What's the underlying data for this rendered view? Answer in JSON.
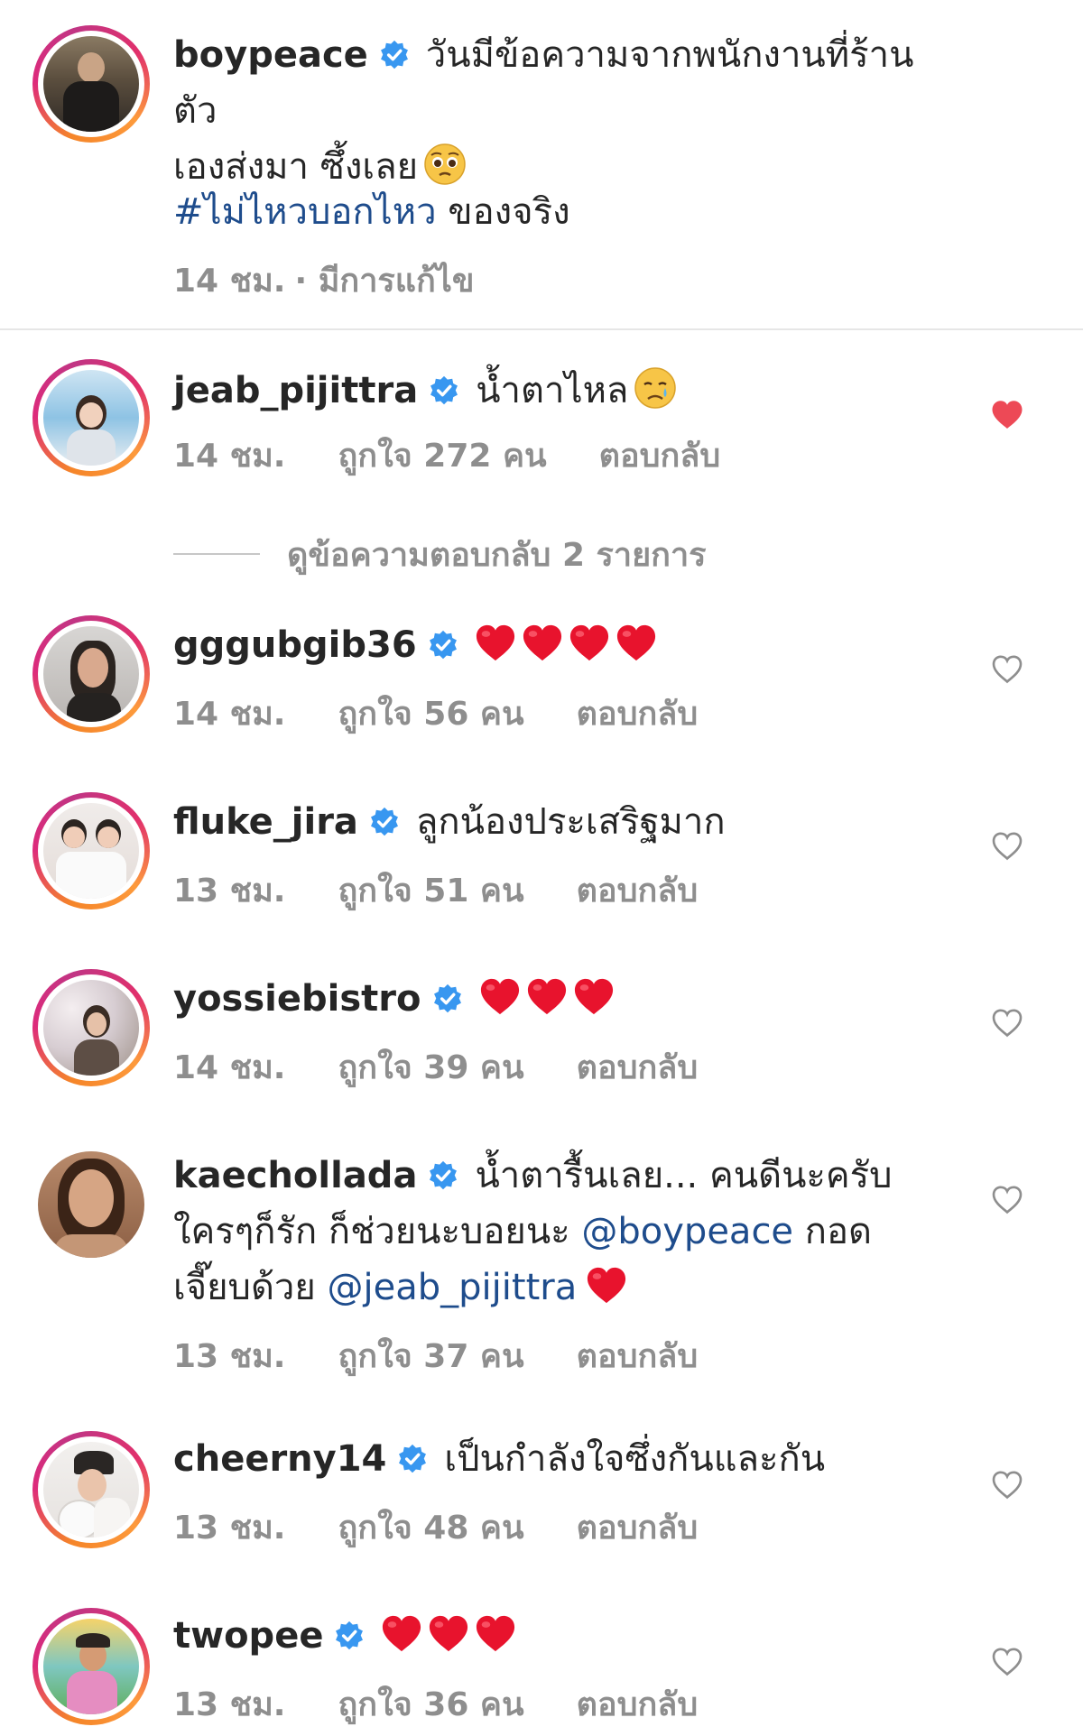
{
  "post": {
    "username": "boypeace",
    "caption_line1": "วันมีข้อความจากพนักงานที่ร้านตัว",
    "caption_line2": "เองส่งมา ซึ้งเลย",
    "hashtag": "#ไม่ไหวบอกไหว",
    "hashtag_suffix": " ของจริง",
    "time": "14 ชม.",
    "edited": "· มีการแก้ไข"
  },
  "view_replies": "ดูข้อความตอบกลับ 2 รายการ",
  "reply_label": "ตอบกลับ",
  "comments": [
    {
      "username": "jeab_pijittra",
      "text": "น้ำตาไหล",
      "time": "14 ชม.",
      "likes": "ถูกใจ 272 คน",
      "liked": true
    },
    {
      "username": "gggubgib36",
      "text": "",
      "hearts": 4,
      "time": "14 ชม.",
      "likes": "ถูกใจ 56 คน",
      "liked": false
    },
    {
      "username": "fluke_jira",
      "text": "ลูกน้องประเสริฐมาก",
      "time": "13 ชม.",
      "likes": "ถูกใจ 51 คน",
      "liked": false
    },
    {
      "username": "yossiebistro",
      "text": "",
      "hearts": 3,
      "time": "14 ชม.",
      "likes": "ถูกใจ 39 คน",
      "liked": false
    },
    {
      "username": "kaechollada",
      "text_line1": "น้ำตารื้นเลย... คนดีนะครับ",
      "text_line2a": "ใครๆก็รัก ก็ช่วยนะบอยนะ ",
      "mention1": "@boypeace",
      "text_line2b": " กอด",
      "text_line3a": "เจี๊ยบด้วย ",
      "mention2": "@jeab_pijittra",
      "time": "13 ชม.",
      "likes": "ถูกใจ 37 คน",
      "liked": false
    },
    {
      "username": "cheerny14",
      "text": "เป็นกำลังใจซึ่งกันและกัน",
      "time": "13 ชม.",
      "likes": "ถูกใจ 48 คน",
      "liked": false
    },
    {
      "username": "twopee",
      "text": "",
      "hearts": 3,
      "time": "13 ชม.",
      "likes": "ถูกใจ 36 คน",
      "liked": false
    }
  ],
  "colors": {
    "liked_heart": "#ed4956",
    "verified": "#3897f0",
    "mention": "#1e4c8c"
  }
}
